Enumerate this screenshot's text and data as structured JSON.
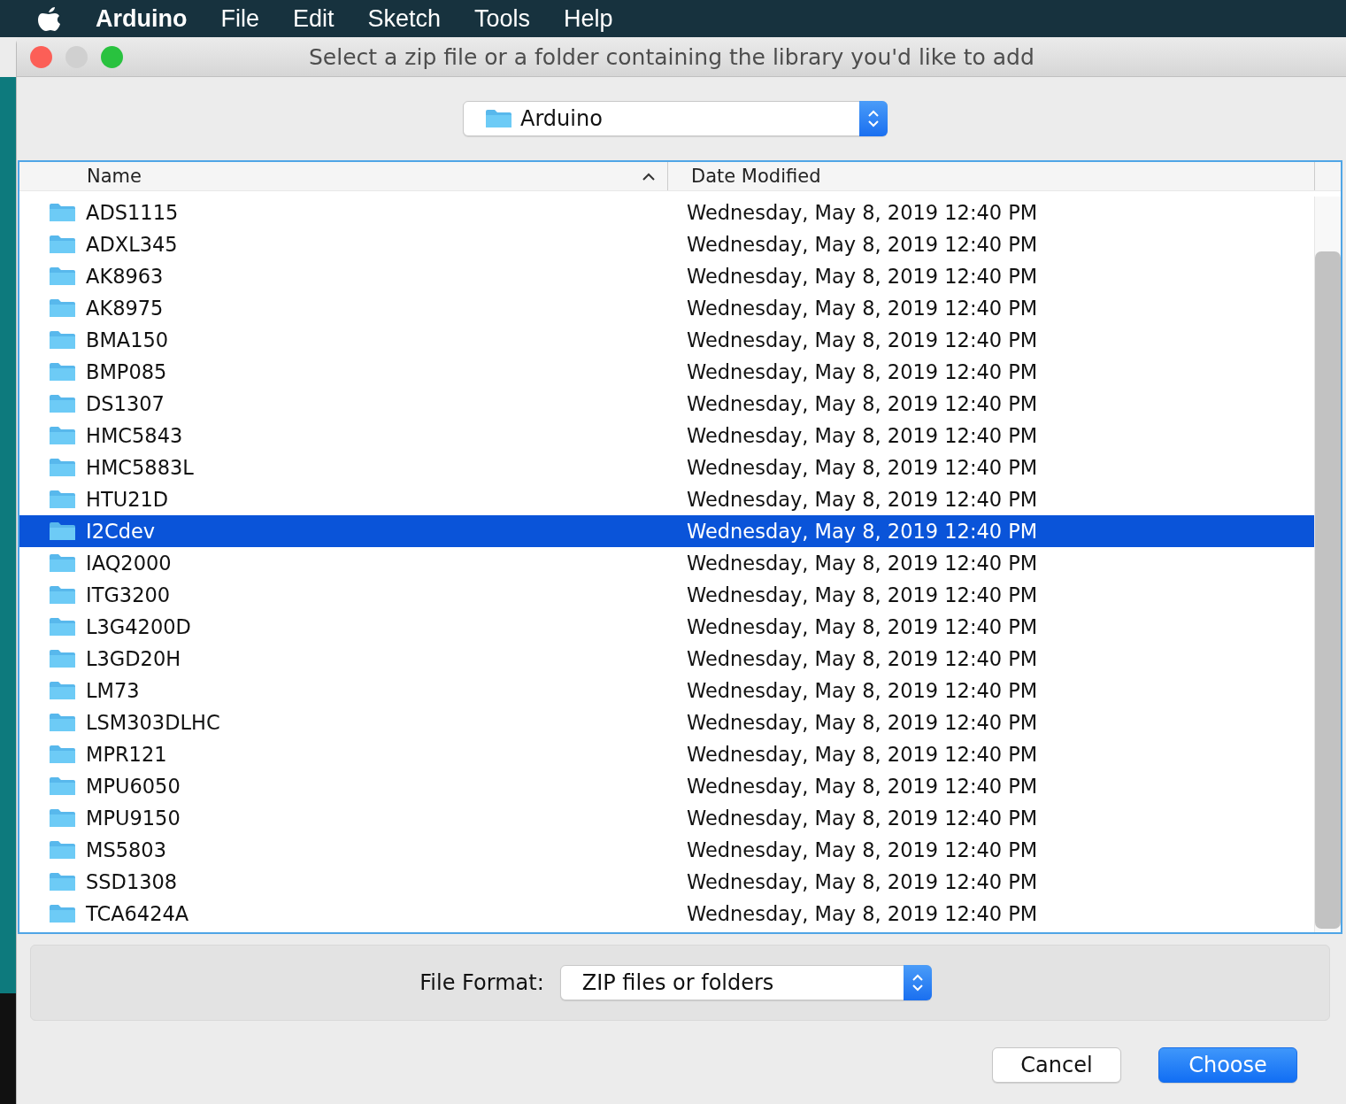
{
  "menu_bar": {
    "app_name": "Arduino",
    "items": [
      "File",
      "Edit",
      "Sketch",
      "Tools",
      "Help"
    ]
  },
  "window": {
    "title": "Select a zip file or a folder containing the library you'd like to add"
  },
  "location": {
    "value": "Arduino"
  },
  "table": {
    "columns": [
      {
        "label": "Name",
        "sorted": true
      },
      {
        "label": "Date Modified",
        "sorted": false
      }
    ],
    "rows": [
      {
        "name": "ADS1115",
        "date": "Wednesday, May 8, 2019 12:40 PM",
        "selected": false
      },
      {
        "name": "ADXL345",
        "date": "Wednesday, May 8, 2019 12:40 PM",
        "selected": false
      },
      {
        "name": "AK8963",
        "date": "Wednesday, May 8, 2019 12:40 PM",
        "selected": false
      },
      {
        "name": "AK8975",
        "date": "Wednesday, May 8, 2019 12:40 PM",
        "selected": false
      },
      {
        "name": "BMA150",
        "date": "Wednesday, May 8, 2019 12:40 PM",
        "selected": false
      },
      {
        "name": "BMP085",
        "date": "Wednesday, May 8, 2019 12:40 PM",
        "selected": false
      },
      {
        "name": "DS1307",
        "date": "Wednesday, May 8, 2019 12:40 PM",
        "selected": false
      },
      {
        "name": "HMC5843",
        "date": "Wednesday, May 8, 2019 12:40 PM",
        "selected": false
      },
      {
        "name": "HMC5883L",
        "date": "Wednesday, May 8, 2019 12:40 PM",
        "selected": false
      },
      {
        "name": "HTU21D",
        "date": "Wednesday, May 8, 2019 12:40 PM",
        "selected": false
      },
      {
        "name": "I2Cdev",
        "date": "Wednesday, May 8, 2019 12:40 PM",
        "selected": true
      },
      {
        "name": "IAQ2000",
        "date": "Wednesday, May 8, 2019 12:40 PM",
        "selected": false
      },
      {
        "name": "ITG3200",
        "date": "Wednesday, May 8, 2019 12:40 PM",
        "selected": false
      },
      {
        "name": "L3G4200D",
        "date": "Wednesday, May 8, 2019 12:40 PM",
        "selected": false
      },
      {
        "name": "L3GD20H",
        "date": "Wednesday, May 8, 2019 12:40 PM",
        "selected": false
      },
      {
        "name": "LM73",
        "date": "Wednesday, May 8, 2019 12:40 PM",
        "selected": false
      },
      {
        "name": "LSM303DLHC",
        "date": "Wednesday, May 8, 2019 12:40 PM",
        "selected": false
      },
      {
        "name": "MPR121",
        "date": "Wednesday, May 8, 2019 12:40 PM",
        "selected": false
      },
      {
        "name": "MPU6050",
        "date": "Wednesday, May 8, 2019 12:40 PM",
        "selected": false
      },
      {
        "name": "MPU9150",
        "date": "Wednesday, May 8, 2019 12:40 PM",
        "selected": false
      },
      {
        "name": "MS5803",
        "date": "Wednesday, May 8, 2019 12:40 PM",
        "selected": false
      },
      {
        "name": "SSD1308",
        "date": "Wednesday, May 8, 2019 12:40 PM",
        "selected": false
      },
      {
        "name": "TCA6424A",
        "date": "Wednesday, May 8, 2019 12:40 PM",
        "selected": false
      }
    ]
  },
  "file_format": {
    "label": "File Format:",
    "value": "ZIP files or folders"
  },
  "buttons": [
    {
      "label": "Cancel",
      "kind": "normal"
    },
    {
      "label": "Choose",
      "kind": "default"
    }
  ]
}
